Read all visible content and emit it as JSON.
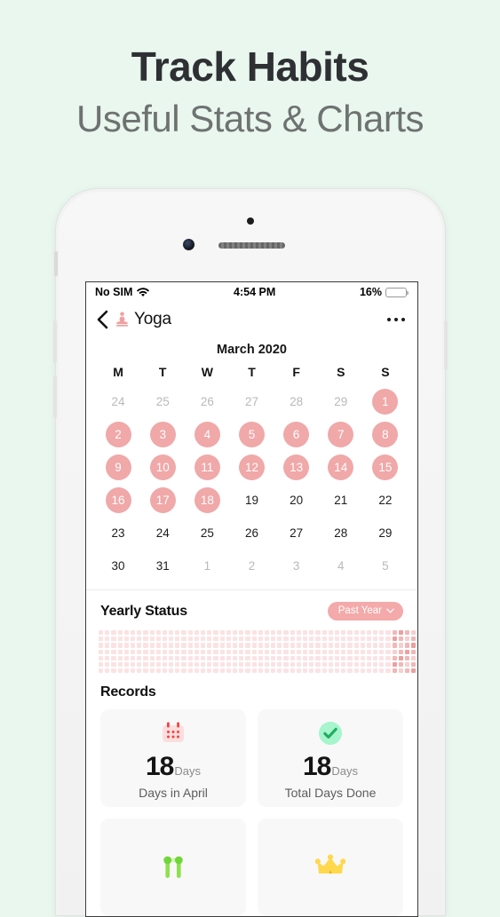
{
  "promo": {
    "title": "Track Habits",
    "subtitle": "Useful Stats & Charts"
  },
  "colors": {
    "background": "#e9f7ee",
    "accent_pink": "#f0a8a8",
    "pill_pink": "#f4aaaa",
    "heat_empty": "#fbe3e3",
    "heat_full": "#ee9f9f",
    "green": "#22c55e",
    "battery_yellow": "#fcbe1f"
  },
  "status_bar": {
    "carrier": "No SIM",
    "wifi_icon": "wifi-icon",
    "time": "4:54 PM",
    "battery_percent": "16%",
    "battery_level": 16
  },
  "nav_bar": {
    "back_icon": "chevron-left-icon",
    "habit_icon": "yoga-figure-icon",
    "title": "Yoga",
    "more_icon": "more-options-icon"
  },
  "calendar": {
    "month_label": "March 2020",
    "weekdays": [
      "M",
      "T",
      "W",
      "T",
      "F",
      "S",
      "S"
    ],
    "weeks": [
      [
        {
          "day": "24",
          "state": "muted"
        },
        {
          "day": "25",
          "state": "muted"
        },
        {
          "day": "26",
          "state": "muted"
        },
        {
          "day": "27",
          "state": "muted"
        },
        {
          "day": "28",
          "state": "muted"
        },
        {
          "day": "29",
          "state": "muted"
        },
        {
          "day": "1",
          "state": "done"
        }
      ],
      [
        {
          "day": "2",
          "state": "done"
        },
        {
          "day": "3",
          "state": "done"
        },
        {
          "day": "4",
          "state": "done"
        },
        {
          "day": "5",
          "state": "done"
        },
        {
          "day": "6",
          "state": "done"
        },
        {
          "day": "7",
          "state": "done"
        },
        {
          "day": "8",
          "state": "done"
        }
      ],
      [
        {
          "day": "9",
          "state": "done"
        },
        {
          "day": "10",
          "state": "done"
        },
        {
          "day": "11",
          "state": "done"
        },
        {
          "day": "12",
          "state": "done"
        },
        {
          "day": "13",
          "state": "done"
        },
        {
          "day": "14",
          "state": "done"
        },
        {
          "day": "15",
          "state": "done"
        }
      ],
      [
        {
          "day": "16",
          "state": "done"
        },
        {
          "day": "17",
          "state": "done"
        },
        {
          "day": "18",
          "state": "done"
        },
        {
          "day": "19",
          "state": "normal"
        },
        {
          "day": "20",
          "state": "normal"
        },
        {
          "day": "21",
          "state": "normal"
        },
        {
          "day": "22",
          "state": "normal"
        }
      ],
      [
        {
          "day": "23",
          "state": "normal"
        },
        {
          "day": "24",
          "state": "normal"
        },
        {
          "day": "25",
          "state": "normal"
        },
        {
          "day": "26",
          "state": "normal"
        },
        {
          "day": "27",
          "state": "normal"
        },
        {
          "day": "28",
          "state": "normal"
        },
        {
          "day": "29",
          "state": "normal"
        }
      ],
      [
        {
          "day": "30",
          "state": "normal"
        },
        {
          "day": "31",
          "state": "normal"
        },
        {
          "day": "1",
          "state": "muted"
        },
        {
          "day": "2",
          "state": "muted"
        },
        {
          "day": "3",
          "state": "muted"
        },
        {
          "day": "4",
          "state": "muted"
        },
        {
          "day": "5",
          "state": "muted"
        }
      ]
    ]
  },
  "yearly_status": {
    "title": "Yearly Status",
    "range_selector": {
      "label": "Past Year",
      "chevron_icon": "chevron-down-icon"
    },
    "heatmap": {
      "rows": 7,
      "columns": 53,
      "filled_start_column": 46,
      "note": "Activity heatmap; cells filled only in the final weeks."
    }
  },
  "records": {
    "title": "Records",
    "cards": [
      {
        "icon": "calendar-dots-icon",
        "value": "18",
        "unit": "Days",
        "label": "Days in April"
      },
      {
        "icon": "check-circle-icon",
        "value": "18",
        "unit": "Days",
        "label": "Total Days Done"
      },
      {
        "icon": "streak-link-icon",
        "value": "",
        "unit": "",
        "label": ""
      },
      {
        "icon": "crown-icon",
        "value": "",
        "unit": "",
        "label": ""
      }
    ]
  }
}
